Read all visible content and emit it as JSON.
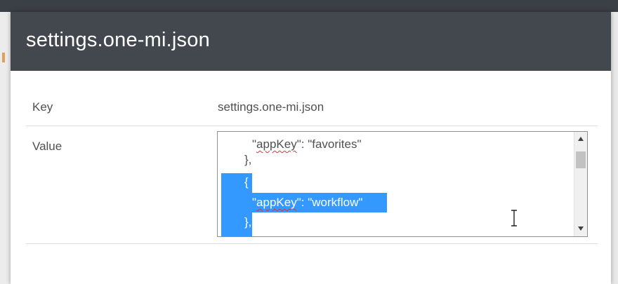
{
  "modal": {
    "title": "settings.one-mi.json",
    "key_label": "Key",
    "key_value": "settings.one-mi.json",
    "value_label": "Value",
    "editor_lines": [
      {
        "pre": "\"",
        "word": "appKey",
        "post": "\": \"favorites\""
      },
      {
        "text": "},"
      },
      {
        "text": "{"
      },
      {
        "pre": "\"",
        "word": "appKey",
        "post": "\": \"workflow\""
      },
      {
        "text": "},"
      }
    ]
  },
  "colors": {
    "header_bg": "#43474e",
    "selection": "#3399ff"
  }
}
